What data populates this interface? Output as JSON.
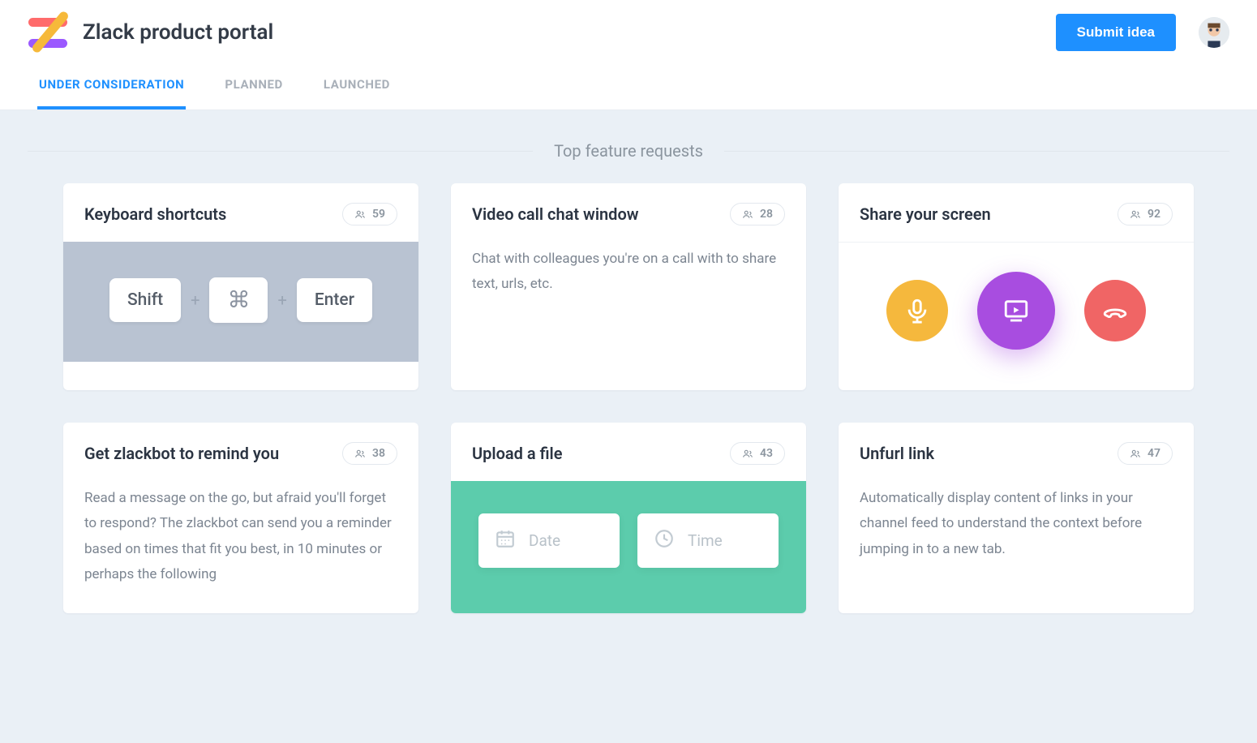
{
  "header": {
    "title": "Zlack product portal",
    "submit_label": "Submit idea"
  },
  "tabs": [
    {
      "label": "UNDER CONSIDERATION"
    },
    {
      "label": "PLANNED"
    },
    {
      "label": "LAUNCHED"
    }
  ],
  "section_title": "Top feature requests",
  "cards": [
    {
      "title": "Keyboard shortcuts",
      "votes": "59",
      "illus": {
        "keys": [
          "Shift",
          "⌘",
          "Enter"
        ]
      }
    },
    {
      "title": "Video call chat window",
      "votes": "28",
      "body": "Chat with colleagues you're on a call with to share text, urls, etc."
    },
    {
      "title": "Share your screen",
      "votes": "92"
    },
    {
      "title": "Get zlackbot to remind you",
      "votes": "38",
      "body": "Read a message on the go, but afraid you'll forget to respond? The zlackbot can send you a reminder based on times that fit you best, in 10 minutes or perhaps the following"
    },
    {
      "title": "Upload a file",
      "votes": "43",
      "illus": {
        "date_label": "Date",
        "time_label": "Time"
      }
    },
    {
      "title": "Unfurl link",
      "votes": "47",
      "body": "Automatically display content of links in your channel feed to understand the context before jumping in to a new tab."
    }
  ]
}
